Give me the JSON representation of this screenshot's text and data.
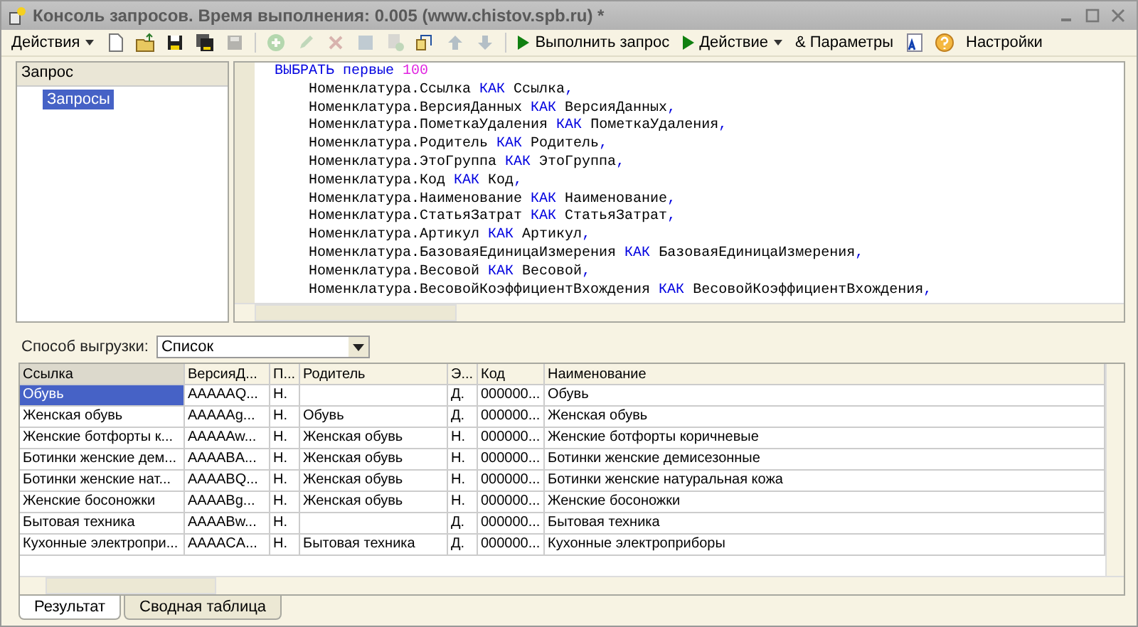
{
  "window": {
    "title": "Консоль запросов. Время выполнения: 0.005 (www.chistov.spb.ru) *"
  },
  "toolbar": {
    "actions_menu": "Действия",
    "run_button": "Выполнить запрос",
    "action_menu": "Действие",
    "params_button": "& Параметры",
    "settings_button": "Настройки"
  },
  "query_tree": {
    "header": "Запрос",
    "items": [
      {
        "label": "Запросы",
        "selected": true
      }
    ]
  },
  "query_text": [
    [
      {
        "text": "ВЫБРАТЬ первые ",
        "kind": "kw"
      },
      {
        "text": "100",
        "kind": "num"
      }
    ],
    [
      {
        "text": "    Номенклатура.Ссылка ",
        "kind": "plain"
      },
      {
        "text": "КАК",
        "kind": "kw"
      },
      {
        "text": " Ссылка",
        "kind": "plain"
      },
      {
        "text": ",",
        "kind": "kw"
      }
    ],
    [
      {
        "text": "    Номенклатура.ВерсияДанных ",
        "kind": "plain"
      },
      {
        "text": "КАК",
        "kind": "kw"
      },
      {
        "text": " ВерсияДанных",
        "kind": "plain"
      },
      {
        "text": ",",
        "kind": "kw"
      }
    ],
    [
      {
        "text": "    Номенклатура.ПометкаУдаления ",
        "kind": "plain"
      },
      {
        "text": "КАК",
        "kind": "kw"
      },
      {
        "text": " ПометкаУдаления",
        "kind": "plain"
      },
      {
        "text": ",",
        "kind": "kw"
      }
    ],
    [
      {
        "text": "    Номенклатура.Родитель ",
        "kind": "plain"
      },
      {
        "text": "КАК",
        "kind": "kw"
      },
      {
        "text": " Родитель",
        "kind": "plain"
      },
      {
        "text": ",",
        "kind": "kw"
      }
    ],
    [
      {
        "text": "    Номенклатура.ЭтоГруппа ",
        "kind": "plain"
      },
      {
        "text": "КАК",
        "kind": "kw"
      },
      {
        "text": " ЭтоГруппа",
        "kind": "plain"
      },
      {
        "text": ",",
        "kind": "kw"
      }
    ],
    [
      {
        "text": "    Номенклатура.Код ",
        "kind": "plain"
      },
      {
        "text": "КАК",
        "kind": "kw"
      },
      {
        "text": " Код",
        "kind": "plain"
      },
      {
        "text": ",",
        "kind": "kw"
      }
    ],
    [
      {
        "text": "    Номенклатура.Наименование ",
        "kind": "plain"
      },
      {
        "text": "КАК",
        "kind": "kw"
      },
      {
        "text": " Наименование",
        "kind": "plain"
      },
      {
        "text": ",",
        "kind": "kw"
      }
    ],
    [
      {
        "text": "    Номенклатура.СтатьяЗатрат ",
        "kind": "plain"
      },
      {
        "text": "КАК",
        "kind": "kw"
      },
      {
        "text": " СтатьяЗатрат",
        "kind": "plain"
      },
      {
        "text": ",",
        "kind": "kw"
      }
    ],
    [
      {
        "text": "    Номенклатура.Артикул ",
        "kind": "plain"
      },
      {
        "text": "КАК",
        "kind": "kw"
      },
      {
        "text": " Артикул",
        "kind": "plain"
      },
      {
        "text": ",",
        "kind": "kw"
      }
    ],
    [
      {
        "text": "    Номенклатура.БазоваяЕдиницаИзмерения ",
        "kind": "plain"
      },
      {
        "text": "КАК",
        "kind": "kw"
      },
      {
        "text": " БазоваяЕдиницаИзмерения",
        "kind": "plain"
      },
      {
        "text": ",",
        "kind": "kw"
      }
    ],
    [
      {
        "text": "    Номенклатура.Весовой ",
        "kind": "plain"
      },
      {
        "text": "КАК",
        "kind": "kw"
      },
      {
        "text": " Весовой",
        "kind": "plain"
      },
      {
        "text": ",",
        "kind": "kw"
      }
    ],
    [
      {
        "text": "    Номенклатура.ВесовойКоэффициентВхождения ",
        "kind": "plain"
      },
      {
        "text": "КАК",
        "kind": "kw"
      },
      {
        "text": " ВесовойКоэффициентВхождения",
        "kind": "plain"
      },
      {
        "text": ",",
        "kind": "kw"
      }
    ]
  ],
  "export_mode": {
    "label": "Способ выгрузки:",
    "value": "Список"
  },
  "table": {
    "columns": [
      "Ссылка",
      "ВерсияД...",
      "П...",
      "Родитель",
      "Э...",
      "Код",
      "Наименование"
    ],
    "rows": [
      {
        "selected": true,
        "cells": [
          "Обувь",
          "AAAAAQ...",
          "Н.",
          "",
          "Д.",
          "000000...",
          "Обувь"
        ]
      },
      {
        "selected": false,
        "cells": [
          "Женская обувь",
          "AAAAAg...",
          "Н.",
          "Обувь",
          "Д.",
          "000000...",
          "Женская обувь"
        ]
      },
      {
        "selected": false,
        "cells": [
          "Женские ботфорты к...",
          "AAAAAw...",
          "Н.",
          "Женская обувь",
          "Н.",
          "000000...",
          "Женские ботфорты коричневые"
        ]
      },
      {
        "selected": false,
        "cells": [
          "Ботинки женские дем...",
          "AAAABA...",
          "Н.",
          "Женская обувь",
          "Н.",
          "000000...",
          "Ботинки женские демисезонные"
        ]
      },
      {
        "selected": false,
        "cells": [
          "Ботинки женские нат...",
          "AAAABQ...",
          "Н.",
          "Женская обувь",
          "Н.",
          "000000...",
          "Ботинки женские натуральная кожа"
        ]
      },
      {
        "selected": false,
        "cells": [
          "Женские босоножки",
          "AAAABg...",
          "Н.",
          "Женская обувь",
          "Н.",
          "000000...",
          "Женские босоножки"
        ]
      },
      {
        "selected": false,
        "cells": [
          "Бытовая техника",
          "AAAABw...",
          "Н.",
          "",
          "Д.",
          "000000...",
          "Бытовая техника"
        ]
      },
      {
        "selected": false,
        "cells": [
          "Кухонные электропри...",
          "AAAACA...",
          "Н.",
          "Бытовая техника",
          "Д.",
          "000000...",
          "Кухонные электроприборы"
        ]
      }
    ]
  },
  "tabs": [
    {
      "label": "Результат",
      "selected": true
    },
    {
      "label": "Сводная таблица",
      "selected": false
    }
  ]
}
